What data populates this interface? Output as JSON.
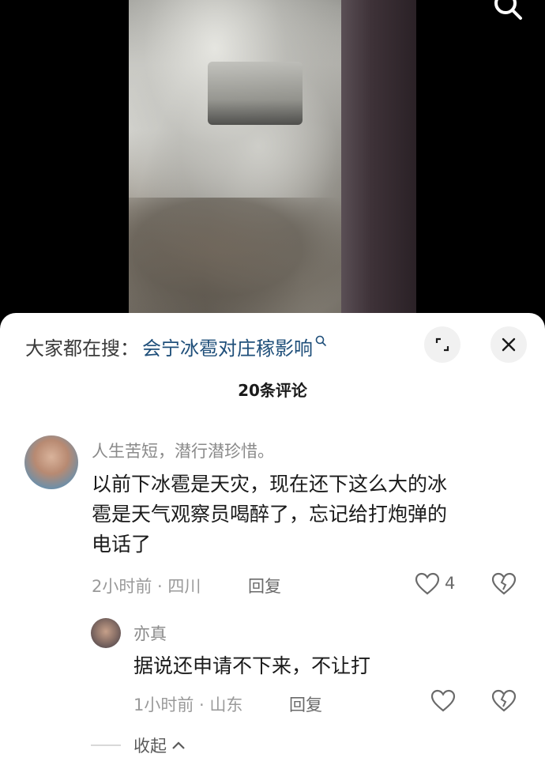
{
  "video": {
    "search_icon": "search-icon"
  },
  "search_bar": {
    "prefix": "大家都在搜：",
    "query": "会宁冰雹对庄稼影响"
  },
  "buttons": {
    "expand_icon": "expand-icon",
    "close_icon": "close-icon"
  },
  "comments_header": {
    "count_label": "20条评论"
  },
  "comment_main": {
    "username": "人生苦短，潜行潜珍惜。",
    "text_line1": "以前下冰雹是天灾，现在还下这么大的冰",
    "text_line2": "雹是天气观察员喝醉了，忘记给打炮弹的",
    "text_line3": "电话了",
    "time_location": "2小时前 · 四川",
    "reply_label": "回复",
    "like_count": "4"
  },
  "comment_reply": {
    "username": "亦真",
    "text": "据说还申请不下来，不让打",
    "time_location": "1小时前 · 山东",
    "reply_label": "回复"
  },
  "collapse": {
    "label": "收起"
  },
  "colors": {
    "link_blue": "#1f4f7a",
    "meta_gray": "#9a9a9a"
  }
}
